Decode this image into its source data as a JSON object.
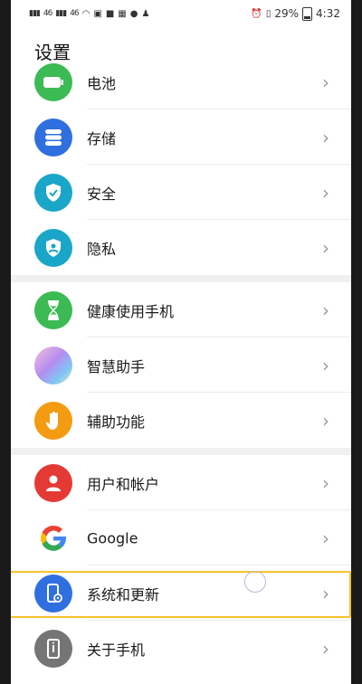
{
  "status_bar": {
    "signal_1": "46",
    "signal_2": "46",
    "battery_percent": "29%",
    "time": "4:32"
  },
  "page": {
    "title": "设置"
  },
  "items": [
    {
      "label": "电池",
      "icon": "battery-icon",
      "color": "#3cba54"
    },
    {
      "label": "存储",
      "icon": "storage-icon",
      "color": "#2f6fe0"
    },
    {
      "label": "安全",
      "icon": "shield-icon",
      "color": "#1aa6c8"
    },
    {
      "label": "隐私",
      "icon": "privacy-icon",
      "color": "#1aa6c8"
    },
    {
      "label": "健康使用手机",
      "icon": "hourglass-icon",
      "color": "#3cba54"
    },
    {
      "label": "智慧助手",
      "icon": "assistant-icon",
      "color": "#b58cf0"
    },
    {
      "label": "辅助功能",
      "icon": "hand-icon",
      "color": "#f39c12"
    },
    {
      "label": "用户和帐户",
      "icon": "user-icon",
      "color": "#e53935"
    },
    {
      "label": "Google",
      "icon": "google-icon",
      "color": "#ffffff"
    },
    {
      "label": "系统和更新",
      "icon": "system-update-icon",
      "color": "#2f6fe0"
    },
    {
      "label": "关于手机",
      "icon": "phone-info-icon",
      "color": "#757575"
    }
  ],
  "chevron": "›",
  "highlight_color": "#f6c12b"
}
